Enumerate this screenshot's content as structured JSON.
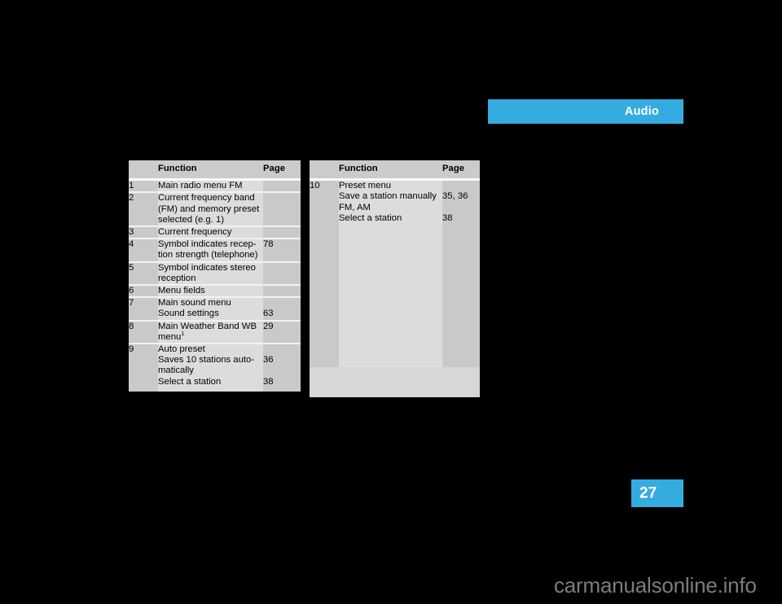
{
  "banner": {
    "label": "Audio",
    "color": "#35ace0"
  },
  "page_tab": {
    "number": "27",
    "color": "#35ace0"
  },
  "watermark": {
    "text": "carmanualsonline.info"
  },
  "tables": {
    "left": {
      "headers": {
        "num": "",
        "function": "Function",
        "page": "Page"
      },
      "rows": [
        {
          "num": "1",
          "function_lines": [
            "Main radio menu FM"
          ],
          "page_lines": [
            ""
          ]
        },
        {
          "num": "2",
          "function_lines": [
            "Current frequency band",
            "(FM) and memory preset",
            "selected (e.g. 1)"
          ],
          "page_lines": [
            "",
            "",
            ""
          ]
        },
        {
          "num": "3",
          "function_lines": [
            "Current frequency"
          ],
          "page_lines": [
            ""
          ]
        },
        {
          "num": "4",
          "function_lines": [
            "Symbol indicates recep-",
            "tion strength (telephone)"
          ],
          "page_lines": [
            "78",
            ""
          ]
        },
        {
          "num": "5",
          "function_lines": [
            "Symbol indicates stereo",
            "reception"
          ],
          "page_lines": [
            "",
            ""
          ]
        },
        {
          "num": "6",
          "function_lines": [
            "Menu fields"
          ],
          "page_lines": [
            ""
          ]
        },
        {
          "num": "7",
          "function_lines": [
            "Main sound menu",
            "Sound settings"
          ],
          "page_lines": [
            "",
            "63"
          ]
        },
        {
          "num": "8",
          "function_lines": [
            "Main Weather Band WB",
            "menu"
          ],
          "footnote": "1",
          "page_lines": [
            "29",
            ""
          ]
        },
        {
          "num": "9",
          "function_lines": [
            "Auto preset",
            "Saves 10 stations auto-",
            "matically",
            "Select a station"
          ],
          "page_lines": [
            "",
            "36",
            "",
            "38"
          ]
        }
      ]
    },
    "right": {
      "headers": {
        "num": "",
        "function": "Function",
        "page": "Page"
      },
      "rows": [
        {
          "num": "10",
          "function_lines": [
            "Preset menu",
            "Save a station manually",
            "FM, AM",
            "Select a station"
          ],
          "page_lines": [
            "",
            "35, 36",
            "",
            "38"
          ]
        }
      ]
    }
  }
}
